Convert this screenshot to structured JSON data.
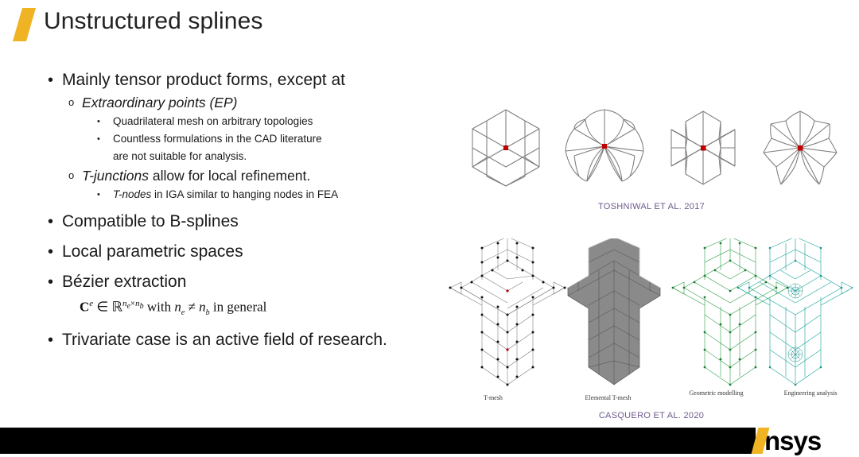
{
  "slide": {
    "title": "Unstructured splines",
    "accent_color": "#F0B323",
    "citation_color": "#6F5B8E"
  },
  "bullets": {
    "b1": "Mainly tensor product forms, except at",
    "b1_sub1_em": "Extraordinary points (EP)",
    "b1_sub1_a": "Quadrilateral mesh on arbitrary topologies",
    "b1_sub1_b": "Countless formulations in the CAD literature",
    "b1_sub1_b_cont": "are not suitable for analysis.",
    "b1_sub2_em": "T-junctions",
    "b1_sub2_rest": " allow for local refinement.",
    "b1_sub2_a_em": "T-nodes",
    "b1_sub2_a_rest": " in IGA similar to hanging nodes in FEA",
    "b2": "Compatible to B-splines",
    "b3": "Local parametric spaces",
    "b4": "Bézier extraction",
    "b5": "Trivariate case is an active field of research.",
    "marker_l1": "•",
    "marker_l2": "o",
    "marker_l3": "•"
  },
  "formula": {
    "c": "C",
    "c_sup": "e",
    "in": " ∈ ",
    "rr": "ℝ",
    "rr_sup_ne": "n",
    "rr_sup_ne_sub": "e",
    "rr_sup_times": "×",
    "rr_sup_nb": "n",
    "rr_sup_nb_sub": "b",
    "with": " with ",
    "ne": "n",
    "ne_sub": "e",
    "neq": " ≠ ",
    "nb": "n",
    "nb_sub": "b",
    "tail": " in general"
  },
  "figures": {
    "top_citation": "TOSHNIWAL ET AL. 2017",
    "bottom_citation": "CASQUERO ET AL. 2020",
    "top_items": [
      {
        "name": "ep-valence-3",
        "valence": 3
      },
      {
        "name": "ep-valence-5",
        "valence": 5
      },
      {
        "name": "ep-valence-6",
        "valence": 6
      },
      {
        "name": "ep-valence-7",
        "valence": 7
      }
    ],
    "bottom_captions": [
      "T-mesh",
      "Elemental T-mesh",
      "Geometric modelling",
      "Engineering analysis"
    ],
    "ep_marker_color": "#C00000",
    "mesh_line_color": "#7d7d7d",
    "green_color": "#2E9E48",
    "teal_color": "#1FA8A0",
    "grey_fill": "#8a8a8a"
  },
  "footer": {
    "logo_word": "nsys",
    "bar_color": "#000000"
  }
}
